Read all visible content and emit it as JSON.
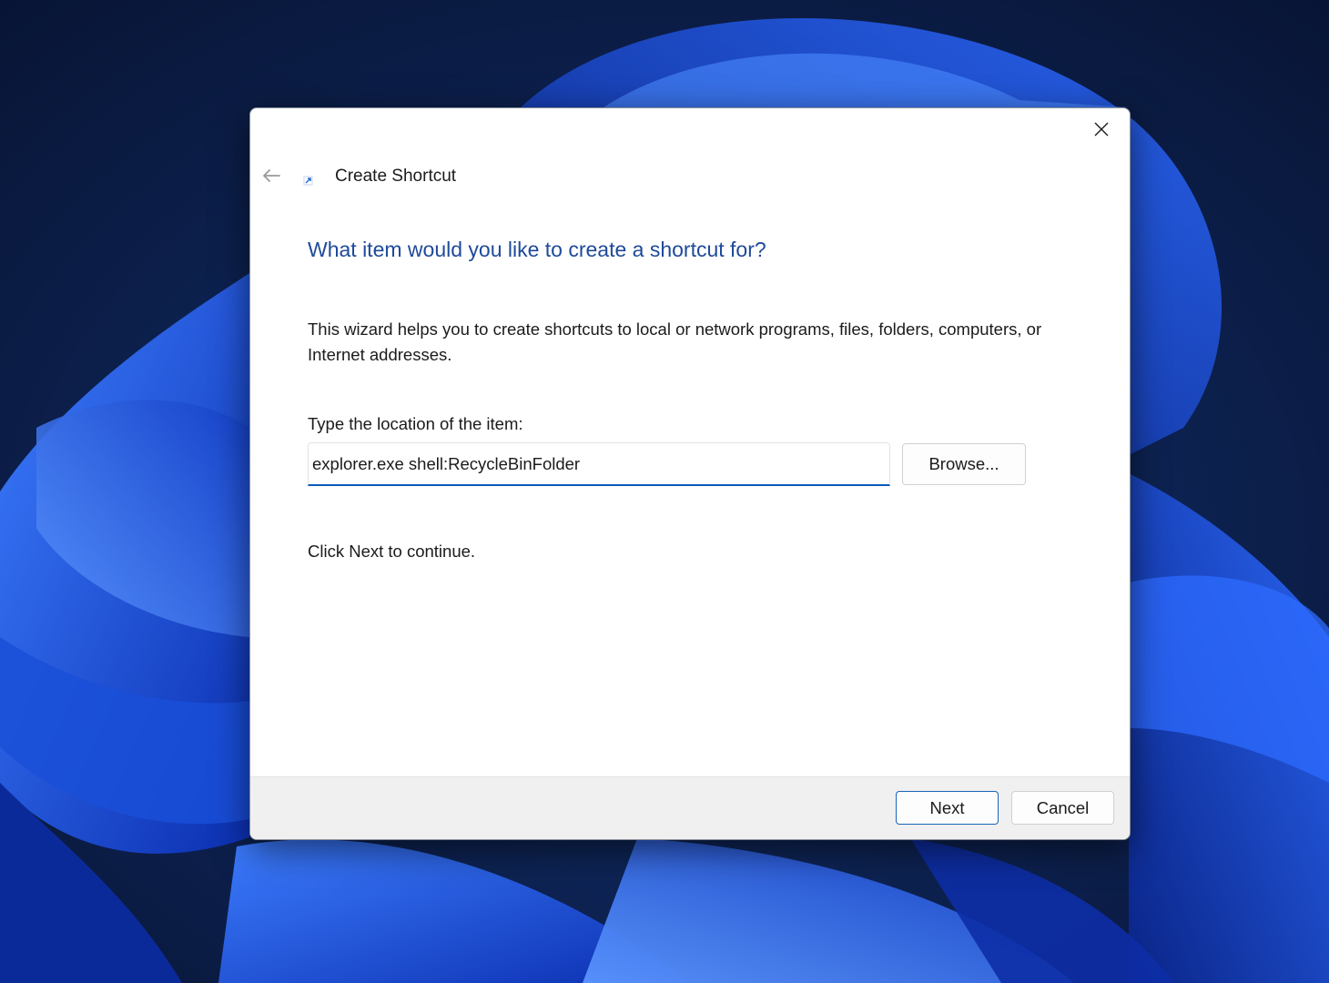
{
  "dialog": {
    "title": "Create Shortcut",
    "heading": "What item would you like to create a shortcut for?",
    "description": "This wizard helps you to create shortcuts to local or network programs, files, folders, computers, or Internet addresses.",
    "location_label": "Type the location of the item:",
    "location_value": "explorer.exe shell:RecycleBinFolder",
    "browse_label": "Browse...",
    "continue_text": "Click Next to continue.",
    "next_label": "Next",
    "cancel_label": "Cancel",
    "icons": {
      "close": "close-icon",
      "back": "back-arrow-icon",
      "wizard": "shortcut-icon"
    }
  },
  "colors": {
    "heading": "#1e4a9a",
    "accent": "#0a5bb5",
    "wallpaper_dark": "#0a1a44",
    "wallpaper_blue": "#1f5fe0"
  }
}
